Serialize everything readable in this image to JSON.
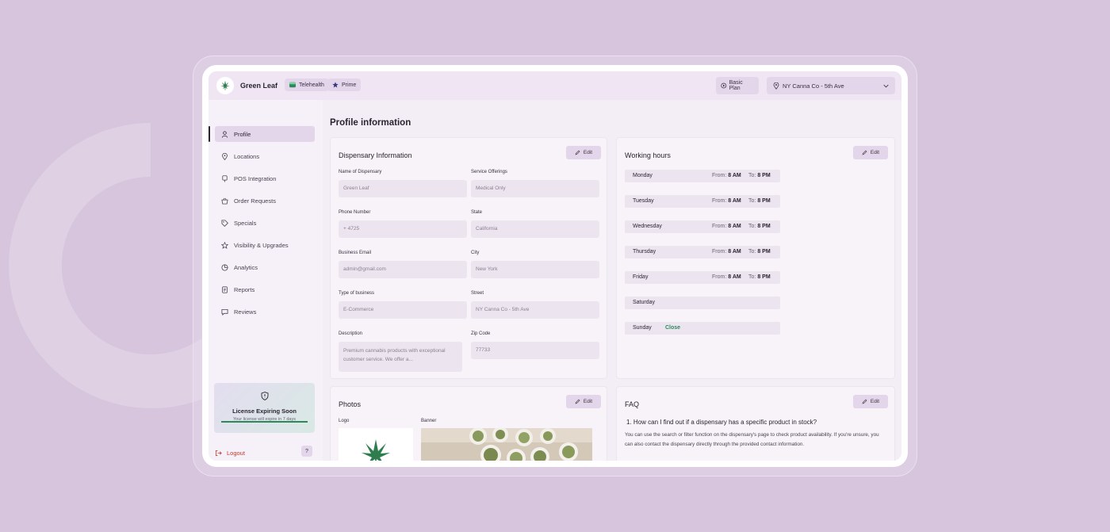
{
  "header": {
    "brand": "Green Leaf",
    "chips": [
      "Telehealth",
      "Prime"
    ],
    "plan": "Basic Plan",
    "location": "NY Canna Co - 5th Ave"
  },
  "sidebar": {
    "items": [
      {
        "label": "Profile",
        "icon": "user-icon"
      },
      {
        "label": "Locations",
        "icon": "pin-icon"
      },
      {
        "label": "POS Integration",
        "icon": "terminal-icon"
      },
      {
        "label": "Order Requests",
        "icon": "basket-icon"
      },
      {
        "label": "Specials",
        "icon": "tag-icon"
      },
      {
        "label": "Visibility & Upgrades",
        "icon": "star-icon"
      },
      {
        "label": "Analytics",
        "icon": "pie-icon"
      },
      {
        "label": "Reports",
        "icon": "document-icon"
      },
      {
        "label": "Reviews",
        "icon": "chat-icon"
      }
    ],
    "license": {
      "title": "License Expiring Soon",
      "subtitle": "Your license will expire in 7 days"
    },
    "logout": "Logout",
    "help": "?"
  },
  "main": {
    "title": "Profile information",
    "edit_label": "Edit",
    "dispensary": {
      "title": "Dispensary Information",
      "fields": {
        "name": {
          "label": "Name of Dispensary",
          "value": "Green Leaf"
        },
        "services": {
          "label": "Service Offerings",
          "value": "Medical Only"
        },
        "phone": {
          "label": "Phone Number",
          "value": "+ 4725"
        },
        "state": {
          "label": "State",
          "value": "California"
        },
        "email": {
          "label": "Business Email",
          "value": "admin@gmail.com"
        },
        "city": {
          "label": "City",
          "value": "New York"
        },
        "type": {
          "label": "Type of business",
          "value": "E-Commerce"
        },
        "street": {
          "label": "Street",
          "value": "NY Canna Co - 5th Ave"
        },
        "description": {
          "label": "Description",
          "value": "Premium cannabis products with exceptional customer service. We offer a..."
        },
        "zip": {
          "label": "Zip Code",
          "value": "77733"
        }
      }
    },
    "working_hours": {
      "title": "Working hours",
      "from_label": "From:",
      "to_label": "To:",
      "days": [
        {
          "day": "Monday",
          "from": "8 AM",
          "to": "8 PM"
        },
        {
          "day": "Tuesday",
          "from": "8 AM",
          "to": "8 PM"
        },
        {
          "day": "Wednesday",
          "from": "8 AM",
          "to": "8 PM"
        },
        {
          "day": "Thursday",
          "from": "8 AM",
          "to": "8 PM"
        },
        {
          "day": "Friday",
          "from": "8 AM",
          "to": "8 PM"
        },
        {
          "day": "Saturday"
        },
        {
          "day": "Sunday",
          "status": "Close"
        }
      ]
    },
    "photos": {
      "title": "Photos",
      "logo_label": "Logo",
      "banner_label": "Banner"
    },
    "faq": {
      "title": "FAQ",
      "question": "1.  How can I find out if a dispensary has a specific product in stock?",
      "answer": "You can use the search or filter function on the dispensary's page to check product availability. If you're unsure, you can also contact the dispensary directly through the provided contact information."
    }
  },
  "colors": {
    "accent": "#e4d6ea",
    "brand_green": "#2c8a5a",
    "logout_red": "#c0392b",
    "background": "#d6c5dc"
  }
}
